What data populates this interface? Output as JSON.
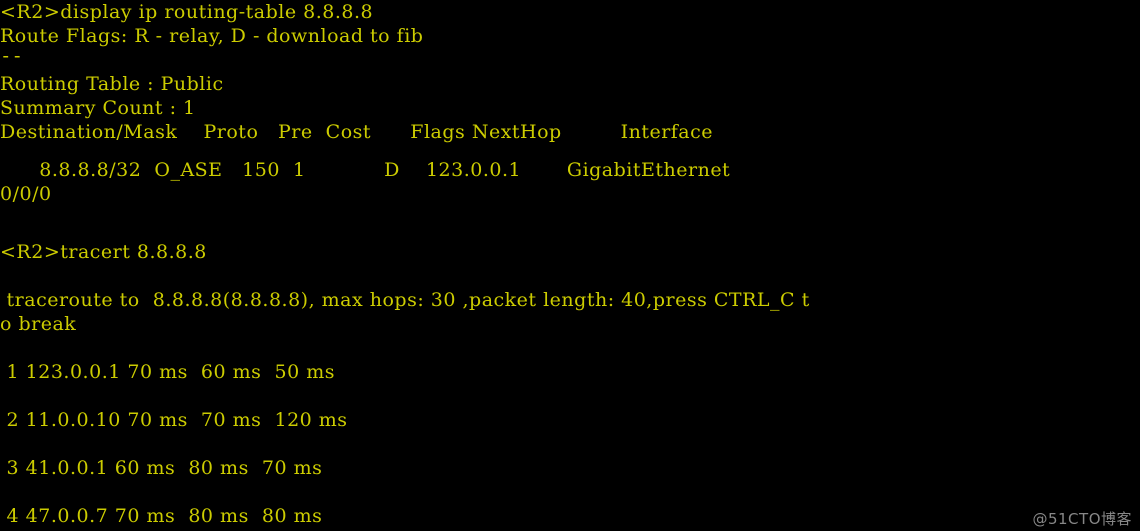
{
  "terminal": {
    "background_color": "#000000",
    "text_color": "#cccc00",
    "watermark_color": "#8f8f8f",
    "watermark": "@51CTO博客",
    "prompt": "<R2>",
    "lines": [
      {
        "id": "cmd-display-routing-table",
        "text": "<R2>display ip routing-table 8.8.8.8",
        "kind": "command"
      },
      {
        "id": "route-flags-legend",
        "text": "Route Flags: R - relay, D - download to fib",
        "kind": "output"
      },
      {
        "id": "separator-rule",
        "text": "------------------------------------------------------------------------------",
        "kind": "rule"
      },
      {
        "id": "blank-1",
        "text": " ",
        "kind": "blank"
      },
      {
        "id": "routing-table-name",
        "text": "Routing Table : Public",
        "kind": "output"
      },
      {
        "id": "summary-count",
        "text": "Summary Count : 1",
        "kind": "output"
      },
      {
        "id": "table-header",
        "text": "Destination/Mask    Proto   Pre  Cost      Flags NextHop         Interface",
        "kind": "header"
      },
      {
        "id": "blank-2",
        "text": " ",
        "kind": "blank"
      },
      {
        "id": "route-entry-row",
        "text": "      8.8.8.8/32  O_ASE   150  1            D    123.0.0.1       GigabitEthernet",
        "kind": "output"
      },
      {
        "id": "route-entry-wrap",
        "text": "0/0/0",
        "kind": "output"
      },
      {
        "id": "blank-3",
        "text": " ",
        "kind": "blank"
      },
      {
        "id": "cmd-tracert",
        "text": "<R2>tracert 8.8.8.8",
        "kind": "command"
      },
      {
        "id": "blank-4",
        "text": " ",
        "kind": "blank"
      },
      {
        "id": "traceroute-banner",
        "text": " traceroute to  8.8.8.8(8.8.8.8), max hops: 30 ,packet length: 40,press CTRL_C t",
        "kind": "output"
      },
      {
        "id": "traceroute-banner-wrap",
        "text": "o break",
        "kind": "output"
      },
      {
        "id": "blank-5",
        "text": " ",
        "kind": "blank"
      },
      {
        "id": "hop-line-1",
        "text": " 1 123.0.0.1 70 ms  60 ms  50 ms",
        "kind": "output"
      },
      {
        "id": "blank-6",
        "text": " ",
        "kind": "blank"
      },
      {
        "id": "hop-line-2",
        "text": " 2 11.0.0.10 70 ms  70 ms  120 ms",
        "kind": "output"
      },
      {
        "id": "blank-7",
        "text": " ",
        "kind": "blank"
      },
      {
        "id": "hop-line-3",
        "text": " 3 41.0.0.1 60 ms  80 ms  70 ms",
        "kind": "output"
      },
      {
        "id": "blank-8",
        "text": " ",
        "kind": "blank"
      },
      {
        "id": "hop-line-4",
        "text": " 4 47.0.0.7 70 ms  80 ms  80 ms",
        "kind": "output"
      }
    ]
  },
  "commands": {
    "display_routing_table": "display ip routing-table 8.8.8.8",
    "tracert": "tracert 8.8.8.8"
  },
  "route_flags": {
    "label": "Route Flags:",
    "relay": "R - relay",
    "download": "D - download to fib",
    "full_text": "Route Flags: R - relay, D - download to fib"
  },
  "routing_table": {
    "name_label": "Routing Table :",
    "name_value": "Public",
    "summary_label": "Summary Count :",
    "summary_value": "1",
    "columns": [
      "Destination/Mask",
      "Proto",
      "Pre",
      "Cost",
      "Flags",
      "NextHop",
      "Interface"
    ],
    "rows": [
      {
        "destination_mask": "8.8.8.8/32",
        "proto": "O_ASE",
        "pre": "150",
        "cost": "1",
        "flags": "D",
        "nexthop": "123.0.0.1",
        "interface": "GigabitEthernet0/0/0"
      }
    ]
  },
  "traceroute": {
    "target": "8.8.8.8",
    "target_resolved": "8.8.8.8",
    "max_hops": "30",
    "packet_length": "40",
    "abort_key": "CTRL_C",
    "banner": " traceroute to  8.8.8.8(8.8.8.8), max hops: 30 ,packet length: 40,press CTRL_C to break",
    "unit": "ms",
    "hops": [
      {
        "hop": "1",
        "address": "123.0.0.1",
        "rtt1": "70",
        "rtt2": "60",
        "rtt3": "50"
      },
      {
        "hop": "2",
        "address": "11.0.0.10",
        "rtt1": "70",
        "rtt2": "70",
        "rtt3": "120"
      },
      {
        "hop": "3",
        "address": "41.0.0.1",
        "rtt1": "60",
        "rtt2": "80",
        "rtt3": "70"
      },
      {
        "hop": "4",
        "address": "47.0.0.7",
        "rtt1": "70",
        "rtt2": "80",
        "rtt3": "80"
      }
    ]
  }
}
